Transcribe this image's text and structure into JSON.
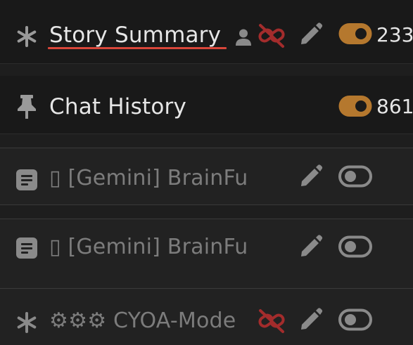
{
  "entries": [
    {
      "type_icon": "asterisk-icon",
      "title": "Story Summary",
      "flags": [
        "user-icon",
        "unlink-icon",
        "pencil-icon"
      ],
      "enabled": true,
      "count": "233"
    },
    {
      "type_icon": "pin-icon",
      "title": "Chat History",
      "flags": [],
      "enabled": true,
      "count": "861"
    },
    {
      "type_icon": "document-icon",
      "title": "▯ [Gemini] BrainFu",
      "flags": [
        "pencil-icon"
      ],
      "enabled": false,
      "count": ""
    },
    {
      "type_icon": "document-icon",
      "title": "▯ [Gemini] BrainFu",
      "flags": [
        "pencil-icon"
      ],
      "enabled": false,
      "count": ""
    },
    {
      "type_icon": "asterisk-icon",
      "title": "⚙⚙⚙ CYOA-Mode",
      "flags": [
        "unlink-icon",
        "pencil-icon"
      ],
      "enabled": false,
      "count": ""
    }
  ],
  "colors": {
    "background": "#1e1e1e",
    "text_active": "#e6e6e6",
    "text_disabled": "#7c7c7c",
    "icon_muted": "#8a8a8a",
    "toggle_on": "#b5782e",
    "unlink_red": "#a32c2c",
    "underline_red": "#d9463a"
  }
}
